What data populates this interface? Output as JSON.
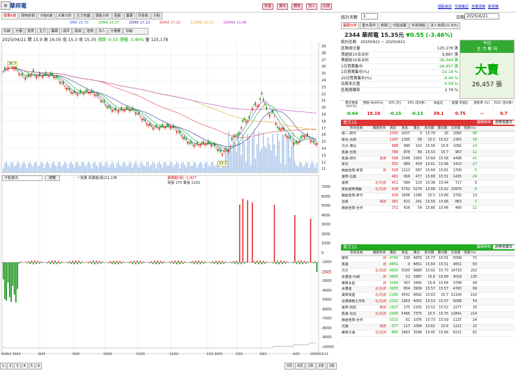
{
  "window": {
    "title": "華邦電",
    "menu_icon": "≡"
  },
  "top_links": [
    "日期",
    "2025/4/21",
    "交易",
    "重要訊息",
    "比較"
  ],
  "top_buttons": [
    "買進",
    "賣出",
    "體檢",
    "加入",
    "比價"
  ],
  "right_links": {
    "date_label": "日期",
    "date_value": "2025/4/21",
    "t1": "個股資訊",
    "t2": "交易筆記",
    "t3": "自選清單",
    "t4": "股票機"
  },
  "chart_tabs": [
    "價量K線",
    "即時走勢",
    "分點K線",
    "大單分析",
    "主力地圖",
    "選股分析",
    "個股",
    "籌碼",
    "月營收",
    "分點"
  ],
  "sub_tabs": [
    "均線",
    "分價",
    "技術",
    "主力",
    "籌碼",
    "成外",
    "融資",
    "借券",
    "法人",
    "分價量",
    "日線"
  ],
  "ma_legend": [
    {
      "label": "5MA",
      "value": "15.70",
      "color": "#3366cc"
    },
    {
      "label": "10MA",
      "value": "15.37",
      "color": "#22aa22"
    },
    {
      "label": "20MA",
      "value": "17.13",
      "color": "#333399"
    },
    {
      "label": "60MA",
      "value": "17.22",
      "color": "#dd4444"
    },
    {
      "label": "120MA",
      "value": "19.23",
      "color": "#ddaa33"
    },
    {
      "label": "200MA",
      "value": "19.48",
      "color": "#bb44bb"
    }
  ],
  "ohlc": {
    "date": "2025/04/21",
    "open": "開 15.9",
    "high": "高 16.05",
    "low": "低 15.3",
    "close": "收 15.35",
    "change": "漲跌 -0.55",
    "pct": "漲幅 -3.46%",
    "volume": "量 125,178"
  },
  "price_axis": [
    "29",
    "28",
    "27",
    "26",
    "25",
    "24",
    "23",
    "22",
    "21",
    "20",
    "19",
    "18",
    "17",
    "16",
    "15",
    "14",
    "13",
    "12",
    "11"
  ],
  "price_marks": {
    "high": "26.7",
    "low": "13.2"
  },
  "lower_tabs": {
    "select": "分點進出",
    "btn": "總覽"
  },
  "lower_legend": {
    "a": "一買賣 買賣超(張)11,136",
    "b": "賣賣超(張) -1,927",
    "c": "買張 175 賣張 2102"
  },
  "lower_axis": [
    "7000",
    "6000",
    "5000",
    "4000",
    "3000",
    "2000",
    "1000",
    "0",
    "-1000",
    "-2000",
    "-3000",
    "-4000",
    "-5000",
    "-6000",
    "-7000",
    "-8000",
    "-9000",
    "-10000"
  ],
  "lower_value_tag": "-1043.",
  "x_axis": [
    "6/28/1 2024",
    "8/01",
    "9/02",
    "10/01",
    "11/01",
    "12/02",
    "1/02 2025",
    "2/03",
    "3/03",
    "4/01",
    "2025/04/21"
  ],
  "pager": [
    "1",
    "2",
    "3",
    "4",
    "5",
    "6"
  ],
  "range_btns": [
    "3月",
    "6月",
    "1年",
    "2年",
    "3年"
  ],
  "summary": {
    "title": "統計天數",
    "days": "1",
    "tabs": [
      "籌碼分析",
      "重大事件",
      "新聞",
      "分點追蹤",
      "外資持股",
      "法人目標(21.6元)"
    ],
    "stock": "2344 華邦電",
    "price": "15.35元",
    "chg": "▼0.55 (-3.46%)",
    "period_label": "統計區間",
    "period": "20250421 ~ 20250421",
    "rows": [
      [
        "區間成交量",
        "125,178 張"
      ],
      [
        "買超前15名合計",
        "9,887 張"
      ],
      [
        "賣超前15名合計",
        "-36,344 張"
      ],
      [
        "1日買賣集中",
        "-26,457 張"
      ],
      [
        "1日買賣集中(%)",
        "-21.14 %"
      ],
      [
        "20日買賣集中(%)",
        "-6.44 %"
      ],
      [
        "佔股本比重",
        "-0.59 %"
      ],
      [
        "區間周轉率",
        "2.78 %"
      ]
    ],
    "today": "今日",
    "direction": "主 力 動 向",
    "verdict": "大賣",
    "verdict_vol": "26,457 張",
    "metrics_head": [
      "累計營收 YoY(%)",
      "營收 MoM(%)",
      "EPS (元)",
      "EPS (近4季)",
      "本益比",
      "股價 淨值比",
      "殖利率 (%)",
      "ROE (近4季)"
    ],
    "metrics": [
      "-0.64",
      "19.19",
      "-0.15",
      "-0.13",
      "39.1",
      "0.75",
      "--",
      "0.7"
    ]
  },
  "buy_table": {
    "title": "買方15",
    "select_label": "籌碼券商:",
    "select_value": "證券營業日",
    "cols": [
      "券商名稱",
      "關鍵券商",
      "買超",
      "買進",
      "賣出",
      "買均價",
      "賣均價",
      "交易量",
      "張數(%)"
    ],
    "rows": [
      [
        "統一-新竹",
        "",
        "2054",
        "2057",
        "3",
        "15.79",
        "16",
        "2060",
        "-88"
      ],
      [
        "新光-台南",
        "",
        "1247",
        "1305",
        "58",
        "15.5",
        "15.62",
        "1363",
        "-18"
      ],
      [
        "元大-潭光",
        "",
        "888",
        "990",
        "102",
        "15.56",
        "15.6",
        "1092",
        "-19"
      ],
      [
        "凱基-台南",
        "",
        "789",
        "878",
        "89",
        "15.53",
        "15.7",
        "967",
        "-12"
      ],
      [
        "凱基-新竹",
        "風券",
        "598",
        "2548",
        "1950",
        "15.69",
        "15.58",
        "4498",
        "-41"
      ],
      [
        "新光",
        "",
        "555",
        "889",
        "434",
        "15.61",
        "15.96",
        "1423",
        "-17"
      ],
      [
        "群益金鼎-新莊",
        "新",
        "526",
        "1113",
        "587",
        "15.64",
        "15.81",
        "1700",
        "-5"
      ],
      [
        "富邦-信義",
        "",
        "481",
        "958",
        "477",
        "15.68",
        "15.51",
        "1435",
        "-24"
      ],
      [
        "富邦",
        "北/先新",
        "451",
        "584",
        "133",
        "15.38",
        "15.44",
        "717",
        "0"
      ],
      [
        "新加坡商瑞銀",
        "北/先新",
        "428",
        "5702",
        "5274",
        "15.68",
        "15.62",
        "10976",
        "-9"
      ],
      [
        "群益金鼎-新竹",
        "",
        "420",
        "1606",
        "1186",
        "15.5",
        "15.66",
        "2792",
        "13"
      ],
      [
        "台新",
        "風新",
        "381",
        "622",
        "241",
        "15.59",
        "15.66",
        "863",
        "-7"
      ],
      [
        "群益金鼎-古亭",
        "",
        "372",
        "426",
        "54",
        "15.66",
        "15.46",
        "480",
        "-12"
      ]
    ]
  },
  "sell_table": {
    "title": "賣方15",
    "select_label": "籌碼券商:",
    "select_value": "證券營業日",
    "cols": [
      "券商名稱",
      "關鍵券商",
      "賣超",
      "買進",
      "賣出",
      "買均價",
      "賣均價",
      "交易量",
      "張數(%)"
    ],
    "rows": [
      [
        "摩利",
        "新",
        "-4749",
        "130",
        "4879",
        "15.77",
        "15.51",
        "5009",
        "71"
      ],
      [
        "凱基",
        "新",
        "-4651",
        "0",
        "4651",
        "15.64",
        "15.51",
        "4651",
        "83"
      ],
      [
        "元大",
        "北/先新",
        "-4650",
        "5030",
        "9680",
        "15.62",
        "15.73",
        "14710",
        "202"
      ],
      [
        "永豐金-內湖",
        "新",
        "-3955",
        "52",
        "3987",
        "15.6",
        "15.69",
        "4019",
        "135"
      ],
      [
        "華南永昌",
        "新",
        "-3184",
        "307",
        "3491",
        "15.6",
        "15.64",
        "3798",
        "94"
      ],
      [
        "永豐金",
        "北/先新",
        "-3055",
        "854",
        "3909",
        "15.57",
        "15.57",
        "4763",
        "69"
      ],
      [
        "美商高盛",
        "北/先新",
        "-2190",
        "4502",
        "6692",
        "15.63",
        "15.7",
        "11194",
        "110"
      ],
      [
        "台灣摩根士丹利",
        "北/先新",
        "-2102",
        "1953",
        "4055",
        "15.53",
        "15.57",
        "6008",
        "54"
      ],
      [
        "富邦-新店",
        "風新",
        "-1927",
        "175",
        "2102",
        "15.52",
        "15.52",
        "2277",
        "33"
      ],
      [
        "凱基-台北",
        "北/先新",
        "-1909",
        "5466",
        "7375",
        "15.5",
        "15.75",
        "12841",
        "214"
      ],
      [
        "群益金鼎-古亭",
        "",
        "-1015",
        "61",
        "1076",
        "15.73",
        "15.59",
        "1137",
        "24"
      ],
      [
        "元富",
        "風新",
        "-977",
        "117",
        "1094",
        "15.61",
        "15.6",
        "1211",
        "22"
      ],
      [
        "華南大通",
        "北/先新",
        "-885",
        "2663",
        "3548",
        "15.45",
        "15.66",
        "6211",
        "81"
      ]
    ]
  }
}
